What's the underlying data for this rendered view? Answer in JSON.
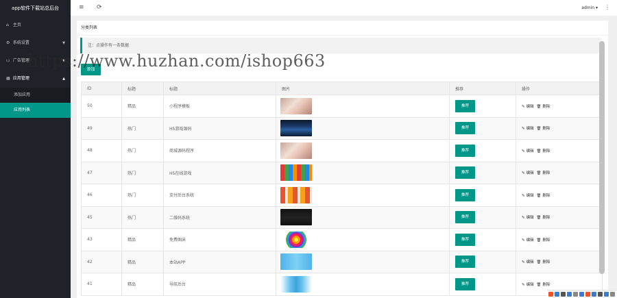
{
  "sidebar": {
    "brand": "app软件下载站总后台",
    "items": [
      {
        "label": "主页",
        "icon": "home-icon"
      },
      {
        "label": "系统设置",
        "icon": "gear-icon",
        "arrow": "▼"
      },
      {
        "label": "广告管理",
        "icon": "ad-icon",
        "arrow": "▼"
      },
      {
        "label": "应用管理",
        "icon": "app-icon",
        "arrow": "▲"
      }
    ],
    "subitems": [
      {
        "label": "添加应用"
      },
      {
        "label": "应用列表"
      }
    ]
  },
  "topbar": {
    "menu_icon": "≡",
    "refresh_icon": "⟳",
    "user": "admin ▾",
    "more_icon": "⋮"
  },
  "main": {
    "card_title": "分类列表",
    "note": "注：点操作有一条数据",
    "add_label": "添加",
    "columns": [
      "ID",
      "标题",
      "标题",
      "图片",
      "推荐",
      "操作"
    ],
    "rows": [
      {
        "id": "50",
        "cat": "精品",
        "title": "小程序模板",
        "rec": "推荐",
        "edit": "编辑",
        "del": "删除",
        "img": "photo-pink"
      },
      {
        "id": "49",
        "cat": "热门",
        "title": "H5游戏源码",
        "rec": "推荐",
        "edit": "编辑",
        "del": "删除",
        "img": "dark-tiles"
      },
      {
        "id": "48",
        "cat": "热门",
        "title": "商城源码程序",
        "rec": "推荐",
        "edit": "编辑",
        "del": "删除",
        "img": "photo-pink"
      },
      {
        "id": "47",
        "cat": "热门",
        "title": "H5在线游戏",
        "rec": "推荐",
        "edit": "编辑",
        "del": "删除",
        "img": "grid-colorful"
      },
      {
        "id": "46",
        "cat": "热门",
        "title": "支付后台系统",
        "rec": "推荐",
        "edit": "编辑",
        "del": "删除",
        "img": "red-tiles"
      },
      {
        "id": "45",
        "cat": "热门",
        "title": "二维码系统",
        "rec": "推荐",
        "edit": "编辑",
        "del": "删除",
        "img": "dark-panel"
      },
      {
        "id": "43",
        "cat": "精品",
        "title": "免费图床",
        "rec": "推荐",
        "edit": "编辑",
        "del": "删除",
        "img": "photos-logo"
      },
      {
        "id": "42",
        "cat": "精品",
        "title": "本站APP",
        "rec": "推荐",
        "edit": "编辑",
        "del": "删除",
        "img": "blue-logo"
      },
      {
        "id": "41",
        "cat": "精品",
        "title": "导航后台",
        "rec": "推荐",
        "edit": "编辑",
        "del": "删除",
        "img": "blue-logo-light"
      }
    ]
  },
  "watermark": "https://www.huzhan.com/ishop663",
  "colors": {
    "accent": "#009688",
    "sidebar": "#20222a"
  }
}
